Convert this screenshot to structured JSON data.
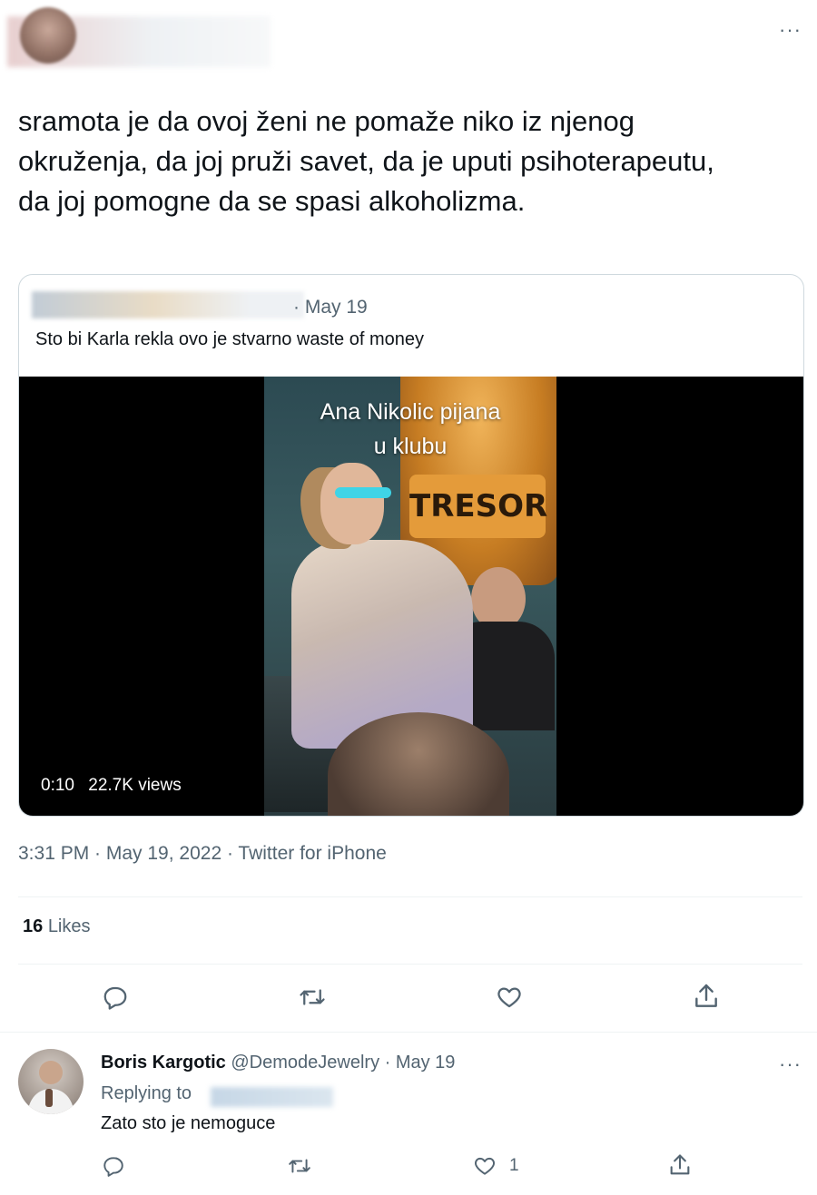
{
  "header": {
    "more_icon": "more-horizontal-icon",
    "more_label": "···"
  },
  "tweet": {
    "text": "sramota je da ovoj ženi ne pomaže niko iz njenog okruženja, da joj pruži savet, da je uputi psihoterapeutu, da joj pomogne da se spasi alkoholizma.",
    "timestamp_line": "3:31 PM · May 19, 2022 · Twitter for iPhone",
    "likes_count": "16",
    "likes_label": "Likes"
  },
  "quote": {
    "date": "· May 19",
    "text": "Sto bi Karla rekla ovo je stvarno waste of money",
    "video": {
      "caption_line1": "Ana Nikolic pijana",
      "caption_line2": "u klubu",
      "sign_text": "TRESOR",
      "duration": "0:10",
      "views": "22.7K views"
    }
  },
  "actions": {
    "reply_icon": "reply-icon",
    "retweet_icon": "retweet-icon",
    "like_icon": "heart-icon",
    "share_icon": "share-icon"
  },
  "reply": {
    "display_name": "Boris Kargotic",
    "handle_date": "@DemodeJewelry · May 19",
    "replying_to_label": "Replying to",
    "text": "Zato sto je nemoguce",
    "like_count": "1",
    "more_label": "···"
  },
  "colors": {
    "text_primary": "#0f1419",
    "text_secondary": "#536471",
    "border": "#cfd9de",
    "divider": "#eff3f4"
  }
}
